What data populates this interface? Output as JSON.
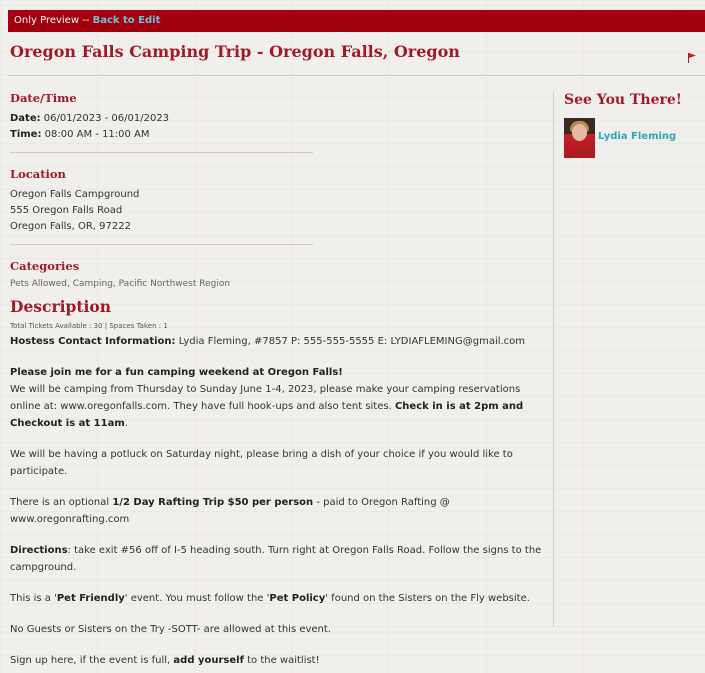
{
  "preview_bar": {
    "text": "Only Preview -- ",
    "link": "Back to Edit"
  },
  "event": {
    "title": "Oregon Falls Camping Trip - Oregon Falls, Oregon"
  },
  "datetime": {
    "heading": "Date/Time",
    "date_label": "Date:",
    "date_value": " 06/01/2023 - 06/01/2023",
    "time_label": "Time:",
    "time_value": " 08:00 AM - 11:00 AM"
  },
  "location": {
    "heading": "Location",
    "line1": "Oregon Falls Campground",
    "line2": "555 Oregon Falls Road",
    "line3": "Oregon Falls, OR, 97222"
  },
  "categories": {
    "heading": "Categories",
    "list": "Pets Allowed, Camping, Pacific Northwest Region"
  },
  "description": {
    "heading": "Description",
    "tickets": "Total Tickets Available : 30 | Spaces Taken : 1",
    "contact_label": "Hostess Contact Information:",
    "contact_value": " Lydia Fleming, #7857    P: 555-555-5555   E: LYDIAFLEMING@gmail.com",
    "intro_bold": "Please join me for a fun camping weekend at Oregon Falls!",
    "intro_text": "We will be camping from Thursday to Sunday June 1-4, 2023, please make your camping reservations online at: www.oregonfalls.com. They have full hook-ups and also tent sites. ",
    "checkin_bold": "Check in is at 2pm and Checkout is at 11am",
    "checkin_end": ".",
    "potluck": "We will be having a potluck on Saturday night, please bring a dish of your choice if you would like to participate.",
    "rafting_pre": "There is an optional ",
    "rafting_bold": "1/2 Day Rafting Trip $50 per person",
    "rafting_post": " - paid to Oregon Rafting @ www.oregonrafting.com",
    "directions_bold": "Directions",
    "directions_text": ": take exit #56 off of I-5 heading south. Turn right at Oregon Falls Road. Follow the signs to the campground.",
    "pet_pre": "This is a '",
    "pet_bold1": "Pet Friendly",
    "pet_mid": "' event. You must follow the '",
    "pet_bold2": "Pet Policy",
    "pet_post": "' found on the Sisters on the Fly website.",
    "guests": "No Guests or Sisters on the Try -SOTT- are allowed at this event.",
    "signup_pre": "Sign up here, if the event is full, ",
    "signup_bold": "add yourself",
    "signup_post": " to the waitlist!"
  },
  "sidebar": {
    "heading": "See You There!",
    "attendees": [
      {
        "name": "Lydia Fleming",
        "avatar": "user-avatar"
      }
    ]
  },
  "colors": {
    "brand_red": "#a3000f",
    "heading_red": "#a11a27",
    "link_teal": "#2aa6bd"
  },
  "icons": [
    "flag-icon"
  ]
}
